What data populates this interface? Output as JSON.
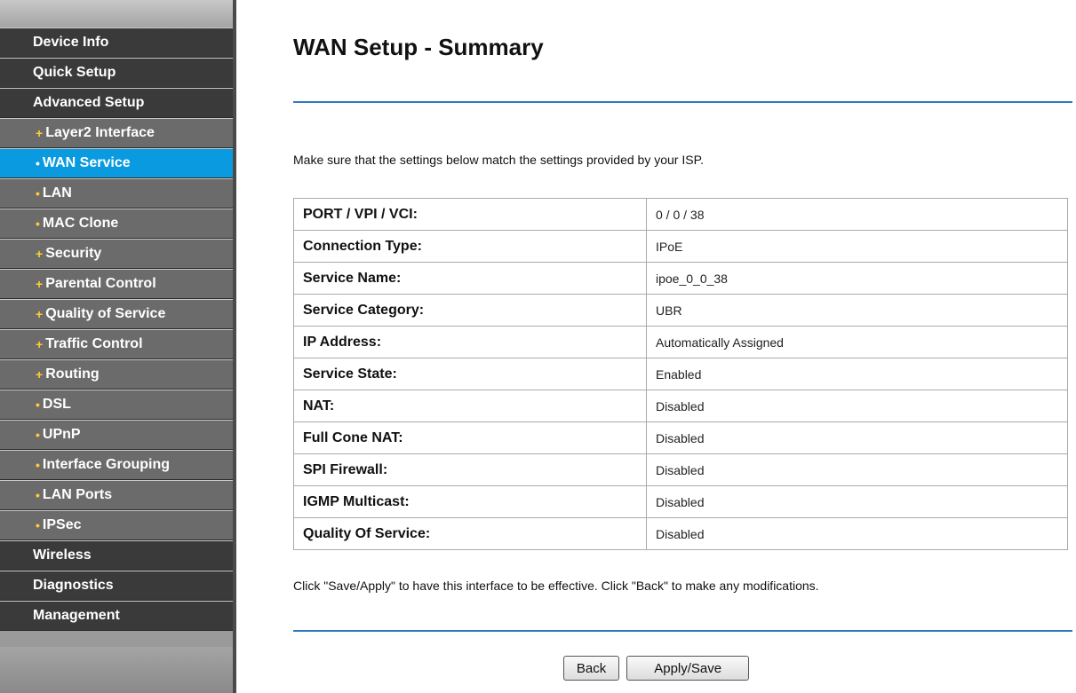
{
  "sidebar": {
    "items": [
      {
        "label": "Device Info",
        "type": "main"
      },
      {
        "label": "Quick Setup",
        "type": "main"
      },
      {
        "label": "Advanced Setup",
        "type": "main"
      },
      {
        "label": "Layer2 Interface",
        "type": "sub",
        "bullet": "+"
      },
      {
        "label": "WAN Service",
        "type": "sub",
        "bullet": "•",
        "active": true
      },
      {
        "label": "LAN",
        "type": "sub",
        "bullet": "•"
      },
      {
        "label": "MAC Clone",
        "type": "sub",
        "bullet": "•"
      },
      {
        "label": "Security",
        "type": "sub",
        "bullet": "+"
      },
      {
        "label": "Parental Control",
        "type": "sub",
        "bullet": "+"
      },
      {
        "label": "Quality of Service",
        "type": "sub",
        "bullet": "+"
      },
      {
        "label": "Traffic Control",
        "type": "sub",
        "bullet": "+"
      },
      {
        "label": "Routing",
        "type": "sub",
        "bullet": "+"
      },
      {
        "label": "DSL",
        "type": "sub",
        "bullet": "•"
      },
      {
        "label": "UPnP",
        "type": "sub",
        "bullet": "•"
      },
      {
        "label": "Interface Grouping",
        "type": "sub",
        "bullet": "•"
      },
      {
        "label": "LAN Ports",
        "type": "sub",
        "bullet": "•"
      },
      {
        "label": "IPSec",
        "type": "sub",
        "bullet": "•"
      },
      {
        "label": "Wireless",
        "type": "main"
      },
      {
        "label": "Diagnostics",
        "type": "main"
      },
      {
        "label": "Management",
        "type": "main"
      }
    ]
  },
  "main": {
    "title": "WAN Setup - Summary",
    "instruction": "Make sure that the settings below match the settings provided by your ISP.",
    "rows": [
      {
        "label": "PORT / VPI / VCI:",
        "value": "0 / 0 / 38"
      },
      {
        "label": "Connection Type:",
        "value": "IPoE"
      },
      {
        "label": "Service Name:",
        "value": "ipoe_0_0_38"
      },
      {
        "label": "Service Category:",
        "value": "UBR"
      },
      {
        "label": "IP Address:",
        "value": "Automatically Assigned"
      },
      {
        "label": "Service State:",
        "value": "Enabled"
      },
      {
        "label": "NAT:",
        "value": "Disabled"
      },
      {
        "label": "Full Cone NAT:",
        "value": "Disabled"
      },
      {
        "label": "SPI Firewall:",
        "value": "Disabled"
      },
      {
        "label": "IGMP Multicast:",
        "value": "Disabled"
      },
      {
        "label": "Quality Of Service:",
        "value": "Disabled"
      }
    ],
    "note": "Click \"Save/Apply\" to have this interface to be effective. Click \"Back\" to make any modifications.",
    "back_label": "Back",
    "apply_label": "Apply/Save"
  },
  "colors": {
    "active_nav": "#0a9ae0",
    "rule": "#2e7bbf",
    "bullet": "#ffcc33"
  }
}
